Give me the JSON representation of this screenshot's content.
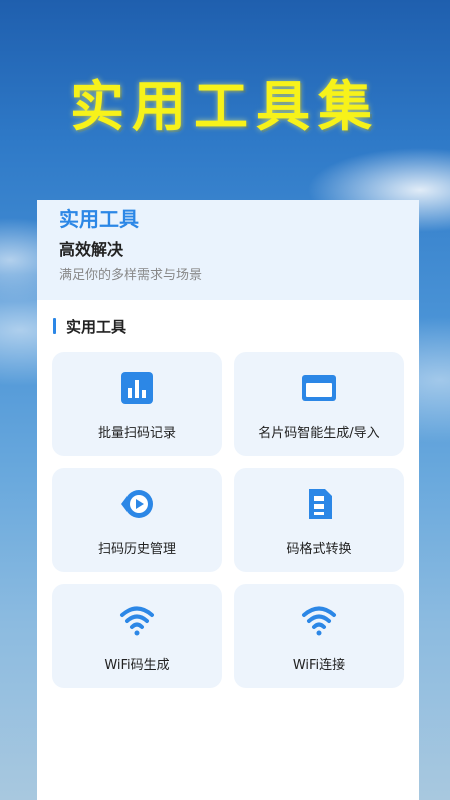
{
  "hero": {
    "title": "实用工具集"
  },
  "card": {
    "header_title": "实用工具",
    "header_subtitle": "高效解决",
    "header_desc": "满足你的多样需求与场景",
    "section_title": "实用工具",
    "tools": [
      {
        "label": "批量扫码记录",
        "icon": "bar-chart-icon"
      },
      {
        "label": "名片码智能生成/导入",
        "icon": "card-icon"
      },
      {
        "label": "扫码历史管理",
        "icon": "history-icon"
      },
      {
        "label": "码格式转换",
        "icon": "format-convert-icon"
      },
      {
        "label": "WiFi码生成",
        "icon": "wifi-icon"
      },
      {
        "label": "WiFi连接",
        "icon": "wifi-icon"
      }
    ]
  },
  "colors": {
    "accent": "#2c87e6",
    "title_yellow": "#f7f21a",
    "tile_bg": "#edf4fc",
    "header_bg": "#eaf3fd"
  }
}
